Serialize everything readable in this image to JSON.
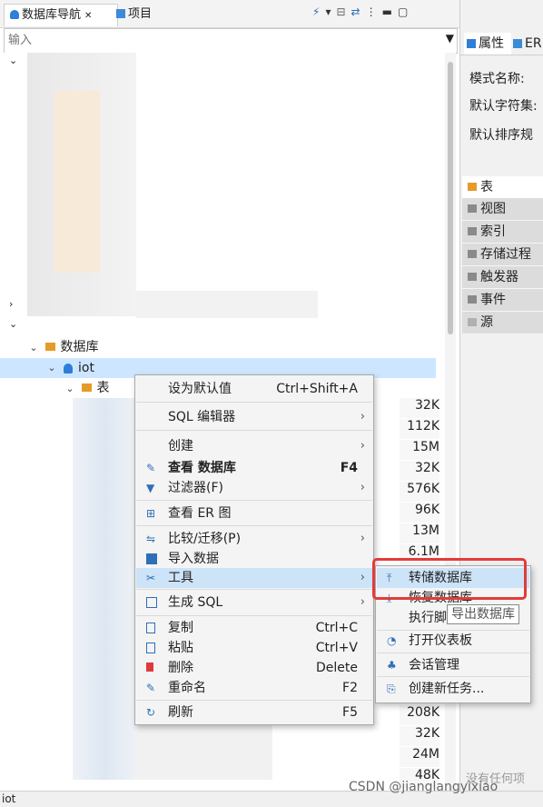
{
  "tabs": {
    "db_nav": "数据库导航",
    "projects": "项目"
  },
  "filter": {
    "placeholder": "输入"
  },
  "tree": {
    "databases_label": "数据库",
    "iot_label": "iot",
    "tables_label": "表"
  },
  "right_panel": {
    "tab_properties": "属性",
    "tab_er": "ER",
    "schema_name": "模式名称:",
    "default_charset": "默认字符集:",
    "default_collation": "默认排序规",
    "sections": [
      "表",
      "视图",
      "索引",
      "存储过程",
      "触发器",
      "事件",
      "源"
    ],
    "no_items": "没有任何项"
  },
  "sizes": [
    "32K",
    "112K",
    "15M",
    "32K",
    "576K",
    "96K",
    "13M",
    "6.1M",
    "",
    "",
    "",
    "",
    "",
    "",
    "",
    "",
    "208K",
    "32K",
    "24M",
    "48K"
  ],
  "context_menu": {
    "items": [
      {
        "label": "设为默认值",
        "shortcut": "Ctrl+Shift+A",
        "bold": false,
        "submenu": false,
        "icon": "none"
      },
      {
        "label": "SQL 编辑器",
        "shortcut": "",
        "bold": false,
        "submenu": true,
        "icon": "none"
      },
      {
        "label": "创建",
        "shortcut": "",
        "bold": false,
        "submenu": true,
        "icon": "none"
      },
      {
        "label": "查看 数据库",
        "shortcut": "F4",
        "bold": true,
        "submenu": false,
        "icon": "edit-icon"
      },
      {
        "label": "过滤器(F)",
        "shortcut": "",
        "bold": false,
        "submenu": true,
        "icon": "filter-icon"
      },
      {
        "label": "查看 ER 图",
        "shortcut": "",
        "bold": false,
        "submenu": false,
        "icon": "er-diagram-icon"
      },
      {
        "label": "比较/迁移(P)",
        "shortcut": "",
        "bold": false,
        "submenu": true,
        "icon": "compare-icon"
      },
      {
        "label": "导入数据",
        "shortcut": "",
        "bold": false,
        "submenu": false,
        "icon": "import-icon"
      },
      {
        "label": "工具",
        "shortcut": "",
        "bold": false,
        "submenu": true,
        "icon": "tools-icon"
      },
      {
        "label": "生成 SQL",
        "shortcut": "",
        "bold": false,
        "submenu": true,
        "icon": "sql-icon"
      },
      {
        "label": "复制",
        "shortcut": "Ctrl+C",
        "bold": false,
        "submenu": false,
        "icon": "copy-icon"
      },
      {
        "label": "粘贴",
        "shortcut": "Ctrl+V",
        "bold": false,
        "submenu": false,
        "icon": "paste-icon"
      },
      {
        "label": "删除",
        "shortcut": "Delete",
        "bold": false,
        "submenu": false,
        "icon": "delete-icon"
      },
      {
        "label": "重命名",
        "shortcut": "F2",
        "bold": false,
        "submenu": false,
        "icon": "rename-icon"
      },
      {
        "label": "刷新",
        "shortcut": "F5",
        "bold": false,
        "submenu": false,
        "icon": "refresh-icon"
      }
    ]
  },
  "tools_submenu": {
    "items": [
      "转储数据库",
      "恢复数据库",
      "执行脚本",
      "打开仪表板",
      "会话管理",
      "创建新任务..."
    ]
  },
  "tooltip": "导出数据库",
  "status": {
    "left": "iot"
  },
  "watermark": "CSDN @jianglangyixiao",
  "colors": {
    "accent": "#1f78d1",
    "highlight_border": "#e33b3b",
    "selection": "#cce6ff"
  }
}
